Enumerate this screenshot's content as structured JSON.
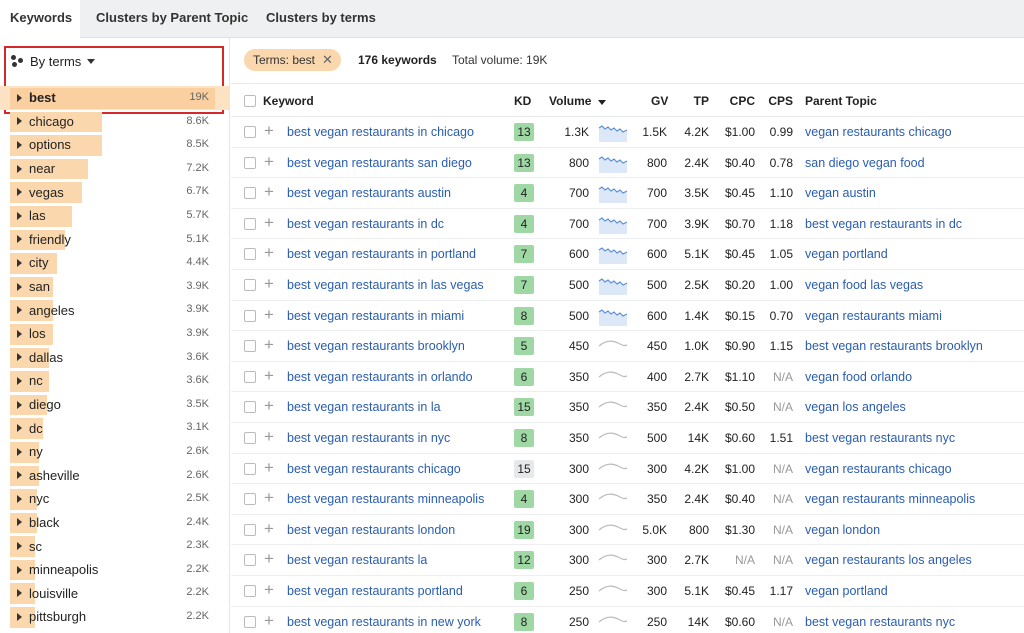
{
  "tabs": [
    {
      "label": "Keywords",
      "active": true
    },
    {
      "label": "Clusters by Parent Topic",
      "active": false
    },
    {
      "label": "Clusters by terms",
      "active": false
    }
  ],
  "sidebar": {
    "mode_label": "By terms",
    "terms": [
      {
        "name": "best",
        "volume": "19K",
        "share": 1.0,
        "selected": true
      },
      {
        "name": "chicago",
        "volume": "8.6K",
        "share": 0.45
      },
      {
        "name": "options",
        "volume": "8.5K",
        "share": 0.45
      },
      {
        "name": "near",
        "volume": "7.2K",
        "share": 0.38
      },
      {
        "name": "vegas",
        "volume": "6.7K",
        "share": 0.35
      },
      {
        "name": "las",
        "volume": "5.7K",
        "share": 0.3
      },
      {
        "name": "friendly",
        "volume": "5.1K",
        "share": 0.27
      },
      {
        "name": "city",
        "volume": "4.4K",
        "share": 0.23
      },
      {
        "name": "san",
        "volume": "3.9K",
        "share": 0.21
      },
      {
        "name": "angeles",
        "volume": "3.9K",
        "share": 0.21
      },
      {
        "name": "los",
        "volume": "3.9K",
        "share": 0.21
      },
      {
        "name": "dallas",
        "volume": "3.6K",
        "share": 0.19
      },
      {
        "name": "nc",
        "volume": "3.6K",
        "share": 0.19
      },
      {
        "name": "diego",
        "volume": "3.5K",
        "share": 0.18
      },
      {
        "name": "dc",
        "volume": "3.1K",
        "share": 0.16
      },
      {
        "name": "ny",
        "volume": "2.6K",
        "share": 0.14
      },
      {
        "name": "asheville",
        "volume": "2.6K",
        "share": 0.14
      },
      {
        "name": "nyc",
        "volume": "2.5K",
        "share": 0.13
      },
      {
        "name": "black",
        "volume": "2.4K",
        "share": 0.13
      },
      {
        "name": "sc",
        "volume": "2.3K",
        "share": 0.12
      },
      {
        "name": "minneapolis",
        "volume": "2.2K",
        "share": 0.12
      },
      {
        "name": "louisville",
        "volume": "2.2K",
        "share": 0.12
      },
      {
        "name": "pittsburgh",
        "volume": "2.2K",
        "share": 0.12
      }
    ]
  },
  "filter": {
    "chip_label": "Terms: best",
    "keyword_count": "176 keywords",
    "total_volume": "Total volume: 19K"
  },
  "table": {
    "headers": {
      "keyword": "Keyword",
      "kd": "KD",
      "volume": "Volume",
      "gv": "GV",
      "tp": "TP",
      "cpc": "CPC",
      "cps": "CPS",
      "parent": "Parent Topic"
    },
    "rows": [
      {
        "keyword": "best vegan restaurants in chicago",
        "kd": "13",
        "volume": "1.3K",
        "gv": "1.5K",
        "tp": "4.2K",
        "cpc": "$1.00",
        "cps": "0.99",
        "parent": "vegan restaurants chicago",
        "trend": "blue"
      },
      {
        "keyword": "best vegan restaurants san diego",
        "kd": "13",
        "volume": "800",
        "gv": "800",
        "tp": "2.4K",
        "cpc": "$0.40",
        "cps": "0.78",
        "parent": "san diego vegan food",
        "trend": "blue"
      },
      {
        "keyword": "best vegan restaurants austin",
        "kd": "4",
        "volume": "700",
        "gv": "700",
        "tp": "3.5K",
        "cpc": "$0.45",
        "cps": "1.10",
        "parent": "vegan austin",
        "trend": "blue"
      },
      {
        "keyword": "best vegan restaurants in dc",
        "kd": "4",
        "volume": "700",
        "gv": "700",
        "tp": "3.9K",
        "cpc": "$0.70",
        "cps": "1.18",
        "parent": "best vegan restaurants in dc",
        "trend": "blue"
      },
      {
        "keyword": "best vegan restaurants in portland",
        "kd": "7",
        "volume": "600",
        "gv": "600",
        "tp": "5.1K",
        "cpc": "$0.45",
        "cps": "1.05",
        "parent": "vegan portland",
        "trend": "blue"
      },
      {
        "keyword": "best vegan restaurants in las vegas",
        "kd": "7",
        "volume": "500",
        "gv": "500",
        "tp": "2.5K",
        "cpc": "$0.20",
        "cps": "1.00",
        "parent": "vegan food las vegas",
        "trend": "blue"
      },
      {
        "keyword": "best vegan restaurants in miami",
        "kd": "8",
        "volume": "500",
        "gv": "600",
        "tp": "1.4K",
        "cpc": "$0.15",
        "cps": "0.70",
        "parent": "vegan restaurants miami",
        "trend": "blue"
      },
      {
        "keyword": "best vegan restaurants brooklyn",
        "kd": "5",
        "volume": "450",
        "gv": "450",
        "tp": "1.0K",
        "cpc": "$0.90",
        "cps": "1.15",
        "parent": "best vegan restaurants brooklyn",
        "trend": "gray"
      },
      {
        "keyword": "best vegan restaurants in orlando",
        "kd": "6",
        "volume": "350",
        "gv": "400",
        "tp": "2.7K",
        "cpc": "$1.10",
        "cps": "N/A",
        "parent": "vegan food orlando",
        "trend": "gray"
      },
      {
        "keyword": "best vegan restaurants in la",
        "kd": "15",
        "volume": "350",
        "gv": "350",
        "tp": "2.4K",
        "cpc": "$0.50",
        "cps": "N/A",
        "parent": "vegan los angeles",
        "trend": "gray"
      },
      {
        "keyword": "best vegan restaurants in nyc",
        "kd": "8",
        "volume": "350",
        "gv": "500",
        "tp": "14K",
        "cpc": "$0.60",
        "cps": "1.51",
        "parent": "best vegan restaurants nyc",
        "trend": "gray"
      },
      {
        "keyword": "best vegan restaurants chicago",
        "kd": "15",
        "volume": "300",
        "gv": "300",
        "tp": "4.2K",
        "cpc": "$1.00",
        "cps": "N/A",
        "parent": "vegan restaurants chicago",
        "trend": "gray"
      },
      {
        "keyword": "best vegan restaurants minneapolis",
        "kd": "4",
        "volume": "300",
        "gv": "350",
        "tp": "2.4K",
        "cpc": "$0.40",
        "cps": "N/A",
        "parent": "vegan restaurants minneapolis",
        "trend": "gray"
      },
      {
        "keyword": "best vegan restaurants london",
        "kd": "19",
        "volume": "300",
        "gv": "5.0K",
        "tp": "800",
        "cpc": "$1.30",
        "cps": "N/A",
        "parent": "vegan london",
        "trend": "gray"
      },
      {
        "keyword": "best vegan restaurants la",
        "kd": "12",
        "volume": "300",
        "gv": "300",
        "tp": "2.7K",
        "cpc": "N/A",
        "cps": "N/A",
        "parent": "vegan restaurants los angeles",
        "trend": "gray"
      },
      {
        "keyword": "best vegan restaurants portland",
        "kd": "6",
        "volume": "250",
        "gv": "300",
        "tp": "5.1K",
        "cpc": "$0.45",
        "cps": "1.17",
        "parent": "vegan portland",
        "trend": "gray"
      },
      {
        "keyword": "best vegan restaurants in new york",
        "kd": "8",
        "volume": "250",
        "gv": "250",
        "tp": "14K",
        "cpc": "$0.60",
        "cps": "N/A",
        "parent": "best vegan restaurants nyc",
        "trend": "gray"
      }
    ]
  },
  "colors": {
    "link": "#2a5db0",
    "term_bar": "#fbd7ad",
    "kd_green": "#9fd8a4",
    "kd_light": "#e6e8ea",
    "highlight_red": "#d62828"
  }
}
